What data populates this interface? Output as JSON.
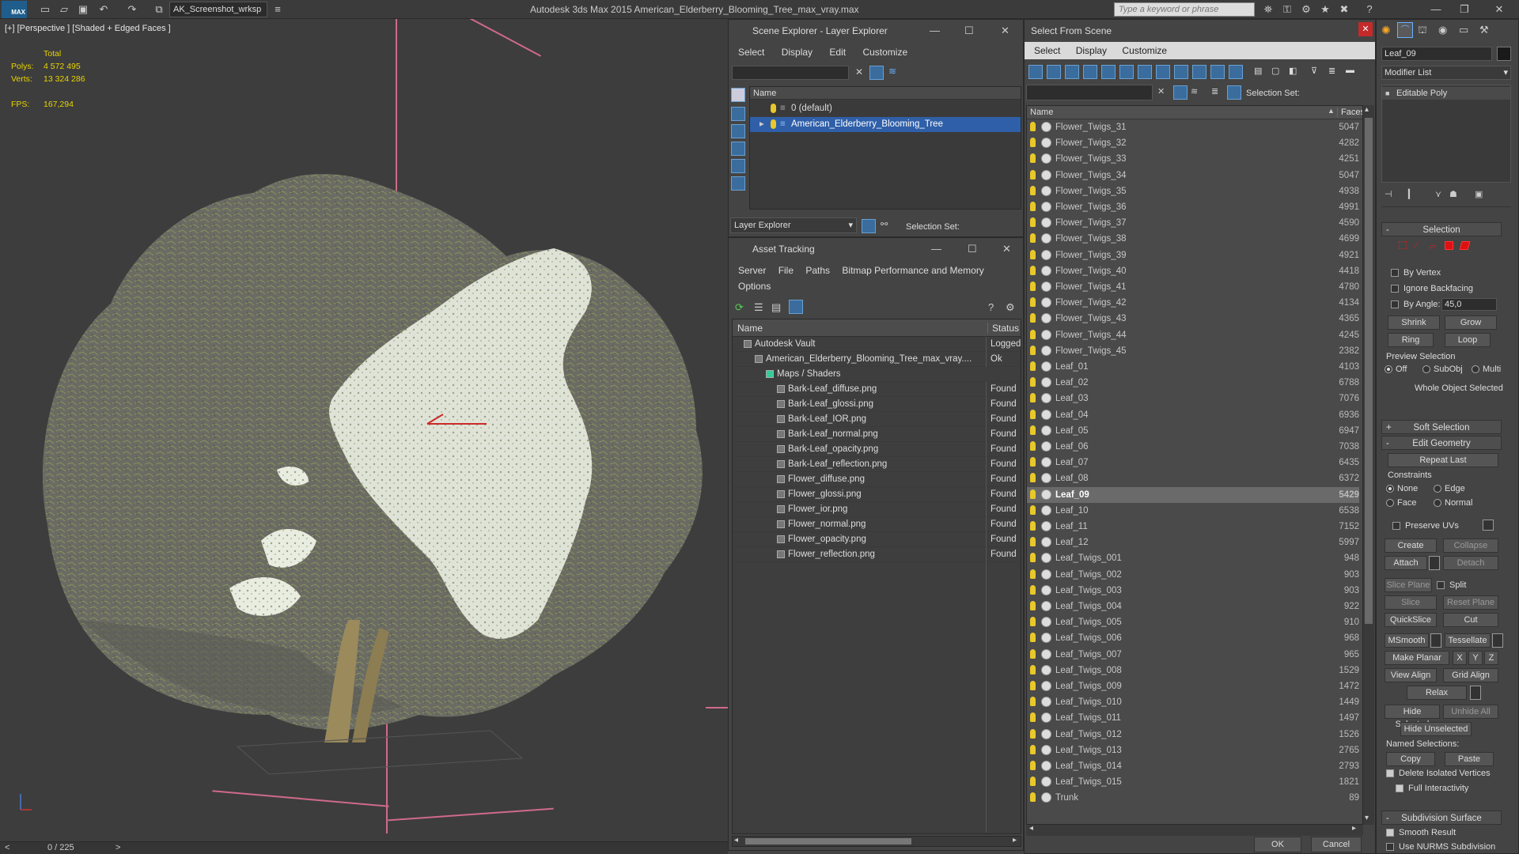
{
  "app": {
    "title": "Autodesk 3ds Max  2015    American_Elderberry_Blooming_Tree_max_vray.max",
    "logo": "MAX",
    "workspace": "AK_Screenshot_wrksp",
    "search_placeholder": "Type a keyword or phrase"
  },
  "viewport": {
    "label": "[+] [Perspective ] [Shaded + Edged Faces ]",
    "stats_total": "Total",
    "polys_label": "Polys:",
    "polys_value": "4 572 495",
    "verts_label": "Verts:",
    "verts_value": "13 324 286",
    "fps_label": "FPS:",
    "fps_value": "167,294",
    "frame_counter": "0 / 225",
    "prev_arrow": "<",
    "next_arrow": ">"
  },
  "scene_explorer": {
    "title": "Scene Explorer - Layer Explorer",
    "menu": [
      "Select",
      "Display",
      "Edit",
      "Customize"
    ],
    "column_name": "Name",
    "layers": [
      {
        "name": "0 (default)",
        "selected": false
      },
      {
        "name": "American_Elderberry_Blooming_Tree",
        "selected": true
      }
    ],
    "bottom_dropdown": "Layer Explorer",
    "selection_set_label": "Selection Set:"
  },
  "asset_tracking": {
    "title": "Asset Tracking",
    "menu_row1": [
      "Server",
      "File",
      "Paths",
      "Bitmap Performance and Memory"
    ],
    "menu_row2": [
      "Options"
    ],
    "col_name": "Name",
    "col_status": "Status",
    "rows": [
      {
        "name": "Autodesk Vault",
        "status": "Logged",
        "indent": 0,
        "icon": "vault-icon"
      },
      {
        "name": "American_Elderberry_Blooming_Tree_max_vray....",
        "status": "Ok",
        "indent": 1,
        "icon": "max-file-icon"
      },
      {
        "name": "Maps / Shaders",
        "status": "",
        "indent": 2,
        "icon": "maps-folder-icon"
      },
      {
        "name": "Bark-Leaf_diffuse.png",
        "status": "Found",
        "indent": 3,
        "icon": "image-file-icon"
      },
      {
        "name": "Bark-Leaf_glossi.png",
        "status": "Found",
        "indent": 3,
        "icon": "image-file-icon"
      },
      {
        "name": "Bark-Leaf_IOR.png",
        "status": "Found",
        "indent": 3,
        "icon": "image-file-icon"
      },
      {
        "name": "Bark-Leaf_normal.png",
        "status": "Found",
        "indent": 3,
        "icon": "image-file-icon"
      },
      {
        "name": "Bark-Leaf_opacity.png",
        "status": "Found",
        "indent": 3,
        "icon": "image-file-icon"
      },
      {
        "name": "Bark-Leaf_reflection.png",
        "status": "Found",
        "indent": 3,
        "icon": "image-file-icon"
      },
      {
        "name": "Flower_diffuse.png",
        "status": "Found",
        "indent": 3,
        "icon": "image-file-icon"
      },
      {
        "name": "Flower_glossi.png",
        "status": "Found",
        "indent": 3,
        "icon": "image-file-icon"
      },
      {
        "name": "Flower_ior.png",
        "status": "Found",
        "indent": 3,
        "icon": "image-file-icon"
      },
      {
        "name": "Flower_normal.png",
        "status": "Found",
        "indent": 3,
        "icon": "image-file-icon"
      },
      {
        "name": "Flower_opacity.png",
        "status": "Found",
        "indent": 3,
        "icon": "image-file-icon"
      },
      {
        "name": "Flower_reflection.png",
        "status": "Found",
        "indent": 3,
        "icon": "image-file-icon"
      }
    ]
  },
  "select_from_scene": {
    "title": "Select From Scene",
    "menu": [
      "Select",
      "Display",
      "Customize"
    ],
    "selection_set_label": "Selection Set:",
    "col_name": "Name",
    "col_faces": "Faces",
    "ok": "OK",
    "cancel": "Cancel",
    "rows": [
      {
        "name": "Flower_Twigs_31",
        "faces": "5047"
      },
      {
        "name": "Flower_Twigs_32",
        "faces": "4282"
      },
      {
        "name": "Flower_Twigs_33",
        "faces": "4251"
      },
      {
        "name": "Flower_Twigs_34",
        "faces": "5047"
      },
      {
        "name": "Flower_Twigs_35",
        "faces": "4938"
      },
      {
        "name": "Flower_Twigs_36",
        "faces": "4991"
      },
      {
        "name": "Flower_Twigs_37",
        "faces": "4590"
      },
      {
        "name": "Flower_Twigs_38",
        "faces": "4699"
      },
      {
        "name": "Flower_Twigs_39",
        "faces": "4921"
      },
      {
        "name": "Flower_Twigs_40",
        "faces": "4418"
      },
      {
        "name": "Flower_Twigs_41",
        "faces": "4780"
      },
      {
        "name": "Flower_Twigs_42",
        "faces": "4134"
      },
      {
        "name": "Flower_Twigs_43",
        "faces": "4365"
      },
      {
        "name": "Flower_Twigs_44",
        "faces": "4245"
      },
      {
        "name": "Flower_Twigs_45",
        "faces": "2382"
      },
      {
        "name": "Leaf_01",
        "faces": "4103"
      },
      {
        "name": "Leaf_02",
        "faces": "6788"
      },
      {
        "name": "Leaf_03",
        "faces": "7076"
      },
      {
        "name": "Leaf_04",
        "faces": "6936"
      },
      {
        "name": "Leaf_05",
        "faces": "6947"
      },
      {
        "name": "Leaf_06",
        "faces": "7038"
      },
      {
        "name": "Leaf_07",
        "faces": "6435"
      },
      {
        "name": "Leaf_08",
        "faces": "6372"
      },
      {
        "name": "Leaf_09",
        "faces": "5429",
        "selected": true
      },
      {
        "name": "Leaf_10",
        "faces": "6538"
      },
      {
        "name": "Leaf_11",
        "faces": "7152"
      },
      {
        "name": "Leaf_12",
        "faces": "5997"
      },
      {
        "name": "Leaf_Twigs_001",
        "faces": "948"
      },
      {
        "name": "Leaf_Twigs_002",
        "faces": "903"
      },
      {
        "name": "Leaf_Twigs_003",
        "faces": "903"
      },
      {
        "name": "Leaf_Twigs_004",
        "faces": "922"
      },
      {
        "name": "Leaf_Twigs_005",
        "faces": "910"
      },
      {
        "name": "Leaf_Twigs_006",
        "faces": "968"
      },
      {
        "name": "Leaf_Twigs_007",
        "faces": "965"
      },
      {
        "name": "Leaf_Twigs_008",
        "faces": "1529"
      },
      {
        "name": "Leaf_Twigs_009",
        "faces": "1472"
      },
      {
        "name": "Leaf_Twigs_010",
        "faces": "1449"
      },
      {
        "name": "Leaf_Twigs_011",
        "faces": "1497"
      },
      {
        "name": "Leaf_Twigs_012",
        "faces": "1526"
      },
      {
        "name": "Leaf_Twigs_013",
        "faces": "2765"
      },
      {
        "name": "Leaf_Twigs_014",
        "faces": "2793"
      },
      {
        "name": "Leaf_Twigs_015",
        "faces": "1821"
      },
      {
        "name": "Trunk",
        "faces": "89"
      }
    ]
  },
  "modify_panel": {
    "object_name": "Leaf_09",
    "modifier_list": "Modifier List",
    "stack_item": "Editable Poly",
    "selection_rollout": "Selection",
    "by_vertex": "By Vertex",
    "ignore_backfacing": "Ignore Backfacing",
    "by_angle": "By Angle:",
    "angle_value": "45,0",
    "shrink": "Shrink",
    "grow": "Grow",
    "ring": "Ring",
    "loop": "Loop",
    "preview_selection": "Preview Selection",
    "preview_off": "Off",
    "preview_subobj": "SubObj",
    "preview_multi": "Multi",
    "whole_object": "Whole Object Selected",
    "soft_selection": "Soft Selection",
    "edit_geometry": "Edit Geometry",
    "repeat_last": "Repeat Last",
    "constraints": "Constraints",
    "c_none": "None",
    "c_edge": "Edge",
    "c_face": "Face",
    "c_normal": "Normal",
    "preserve_uvs": "Preserve UVs",
    "create": "Create",
    "collapse": "Collapse",
    "attach": "Attach",
    "detach": "Detach",
    "slice_plane": "Slice Plane",
    "split": "Split",
    "slice": "Slice",
    "reset_plane": "Reset Plane",
    "quickslice": "QuickSlice",
    "cut": "Cut",
    "msmooth": "MSmooth",
    "tessellate": "Tessellate",
    "make_planar": "Make Planar",
    "x": "X",
    "y": "Y",
    "z": "Z",
    "view_align": "View Align",
    "grid_align": "Grid Align",
    "relax": "Relax",
    "hide_selected": "Hide Selected",
    "unhide_all": "Unhide All",
    "hide_unselected": "Hide Unselected",
    "named_selections": "Named Selections:",
    "copy": "Copy",
    "paste": "Paste",
    "delete_isolated": "Delete Isolated Vertices",
    "full_interactivity": "Full Interactivity",
    "subdivision_surface": "Subdivision Surface",
    "smooth_result": "Smooth Result",
    "use_nurms": "Use NURMS Subdivision"
  },
  "colors": {
    "accent": "#2f5fa8",
    "stats": "#e8d400",
    "selection": "#cc1d1d"
  }
}
